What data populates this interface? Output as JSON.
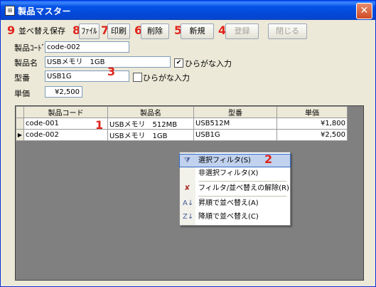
{
  "window": {
    "title": "製品マスター"
  },
  "toolbar": [
    {
      "id": "sort-save",
      "marker": "9",
      "label": "並べ替え保存",
      "disabled": false
    },
    {
      "id": "file",
      "marker": "8",
      "label": "ﾌｧｲﾙ",
      "disabled": false
    },
    {
      "id": "print",
      "marker": "7",
      "label": "印刷",
      "disabled": false
    },
    {
      "id": "delete",
      "marker": "6",
      "label": "削除",
      "disabled": false
    },
    {
      "id": "new",
      "marker": "5",
      "label": "新規",
      "disabled": false
    },
    {
      "id": "register",
      "marker": "4",
      "label": "登録",
      "disabled": true
    },
    {
      "id": "close",
      "marker": "",
      "label": "閉じる",
      "disabled": true
    }
  ],
  "form": {
    "code_label": "製品ｺｰﾄﾞ",
    "code_value": "code-002",
    "name_label": "製品名",
    "name_value": "USBメモリ　1GB",
    "name_hiragana_label": "ひらがな入力",
    "name_hiragana_checked": "✔",
    "model_label": "型番",
    "model_value": "USB1G",
    "model_hiragana_label": "ひらがな入力",
    "price_label": "単価",
    "price_value": "¥2,500",
    "marker": "3"
  },
  "grid": {
    "marker": "1",
    "columns": [
      "製品コード",
      "製品名",
      "型番",
      "単価"
    ],
    "rows": [
      {
        "selector": "",
        "cells": [
          "code-001",
          "USBメモリ　512MB",
          "USB512M",
          "¥1,800"
        ]
      },
      {
        "selector": "▶",
        "cells": [
          "code-002",
          "USBメモリ　1GB",
          "USB1G",
          "¥2,500"
        ]
      }
    ]
  },
  "context_menu": {
    "marker": "2",
    "items": [
      {
        "icon": "filter-icon",
        "glyph": "⧩",
        "label": "選択フィルタ(S)",
        "active": true
      },
      {
        "icon": "",
        "glyph": "",
        "label": "非選択フィルタ(X)",
        "active": false
      },
      {
        "icon": "remove-filter-icon",
        "glyph": "✘",
        "label": "フィルタ/並べ替えの解除(R)",
        "active": false
      },
      {
        "icon": "sort-ascending-icon",
        "glyph": "A↓",
        "label": "昇順で並べ替え(A)",
        "active": false
      },
      {
        "icon": "sort-descending-icon",
        "glyph": "Z↓",
        "label": "降順で並べ替え(C)",
        "active": false
      }
    ]
  },
  "colors": {
    "marker": "#e0241b",
    "titlebar": "#0453e8",
    "menu_highlight": "#c1d2ee"
  }
}
